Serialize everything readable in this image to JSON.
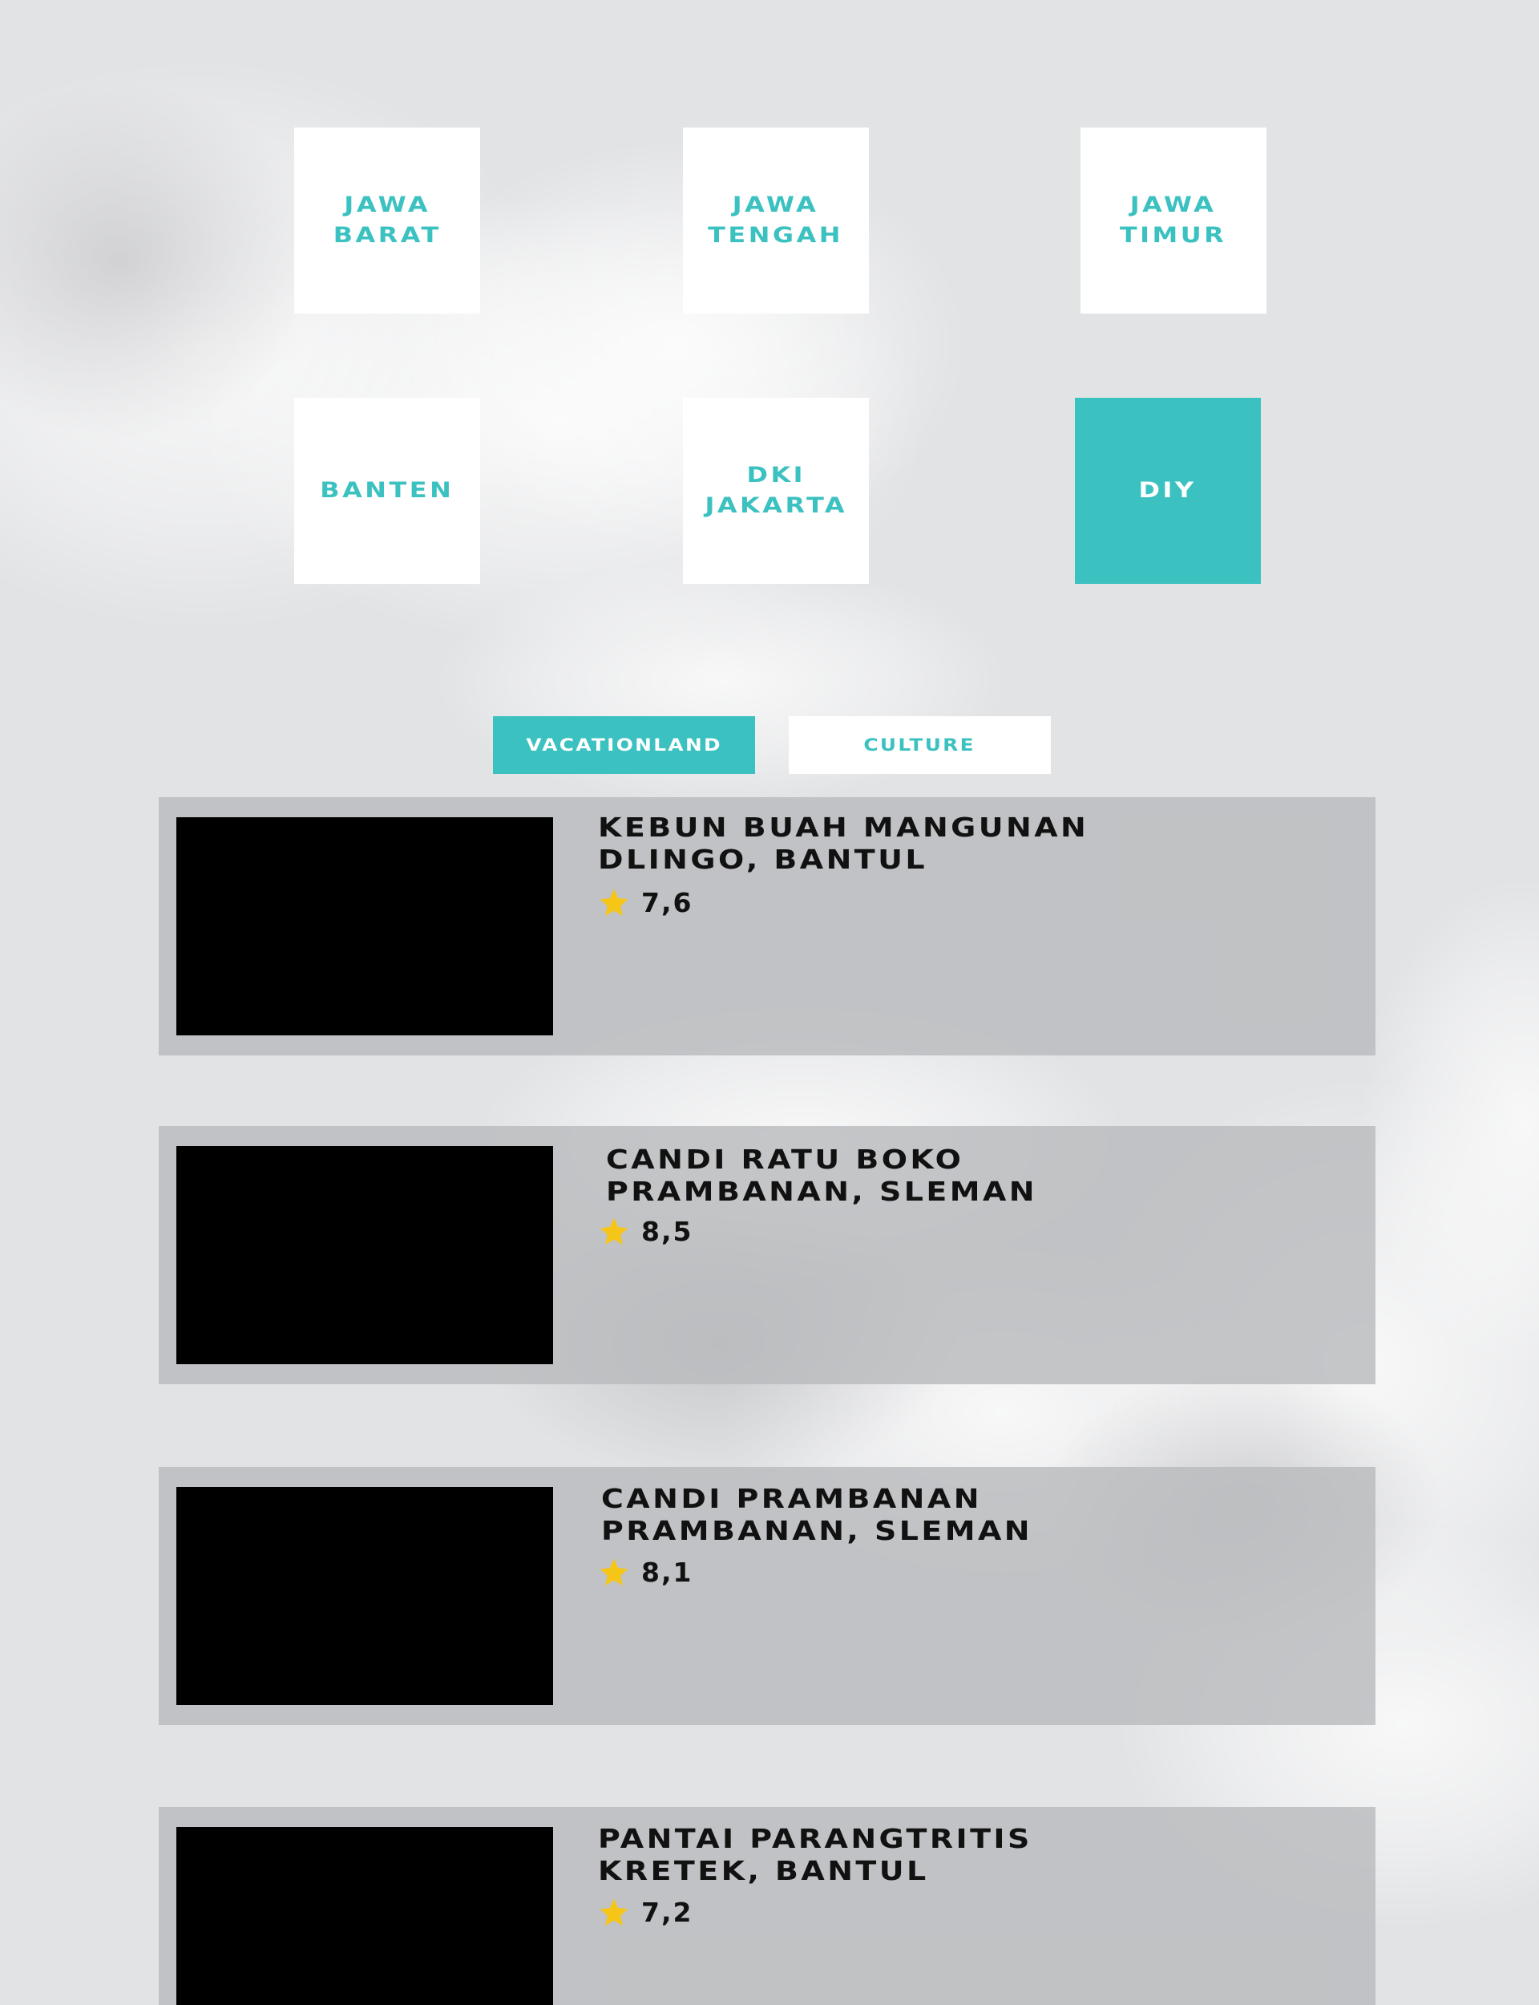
{
  "regions": [
    {
      "label": "JAWA\nBARAT",
      "active": false
    },
    {
      "label": "JAWA\nTENGAH",
      "active": false
    },
    {
      "label": "JAWA\nTIMUR",
      "active": false
    },
    {
      "label": "BANTEN",
      "active": false
    },
    {
      "label": "DKI\nJAKARTA",
      "active": false
    },
    {
      "label": "DIY",
      "active": true
    }
  ],
  "tabs": [
    {
      "label": "VACATIONLAND",
      "active": true
    },
    {
      "label": "CULTURE",
      "active": false
    }
  ],
  "places": [
    {
      "title": "KEBUN BUAH MANGUNAN",
      "location": "DLINGO, BANTUL",
      "rating": "7,6"
    },
    {
      "title": "CANDI RATU BOKO",
      "location": "PRAMBANAN, SLEMAN",
      "rating": "8,5"
    },
    {
      "title": "CANDI PRAMBANAN",
      "location": "PRAMBANAN, SLEMAN",
      "rating": "8,1"
    },
    {
      "title": "PANTAI PARANGTRITIS",
      "location": "KRETEK, BANTUL",
      "rating": "7,2"
    }
  ],
  "colors": {
    "accent": "#3cc1c1",
    "star": "#f5c518",
    "background": "#e2e3e5",
    "card": "#bebfc1"
  },
  "icons": {
    "rating": "star-icon"
  }
}
